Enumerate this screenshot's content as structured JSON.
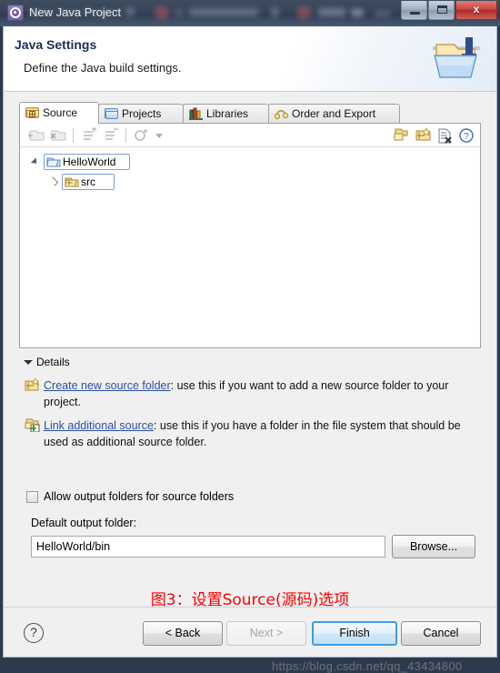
{
  "window": {
    "title": "New Java Project",
    "app_icon": "gear-icon",
    "controls": {
      "minimize": "minimize-button",
      "maximize": "maximize-button",
      "close_label": "x"
    }
  },
  "banner": {
    "title": "Java Settings",
    "subtitle": "Define the Java build settings.",
    "icon": "java-folder-icon"
  },
  "tabs": [
    {
      "label": "Source",
      "icon": "package-folder-icon",
      "active": true
    },
    {
      "label": "Projects",
      "icon": "open-folder-icon",
      "active": false
    },
    {
      "label": "Libraries",
      "icon": "books-icon",
      "active": false
    },
    {
      "label": "Order and Export",
      "icon": "order-export-icon",
      "active": false
    }
  ],
  "toolbar": {
    "left_buttons": [
      {
        "name": "add-folder-button",
        "enabled": false
      },
      {
        "name": "remove-folder-button",
        "enabled": false
      },
      {
        "name": "add-exclusion-button",
        "enabled": false
      },
      {
        "name": "remove-exclusion-button",
        "enabled": false
      },
      {
        "name": "configure-filters-button",
        "enabled": false
      }
    ],
    "right_buttons": [
      {
        "name": "link-source-button",
        "enabled": true
      },
      {
        "name": "create-source-folder-button",
        "enabled": true
      },
      {
        "name": "remove-source-button",
        "enabled": true
      },
      {
        "name": "help-button",
        "enabled": true
      }
    ]
  },
  "tree": {
    "nodes": [
      {
        "label": "HelloWorld",
        "icon": "project-folder-icon",
        "expanded": true,
        "selected": true,
        "indent": 0
      },
      {
        "label": "src",
        "icon": "source-folder-icon",
        "expanded": false,
        "selected": false,
        "indent": 1
      }
    ]
  },
  "details": {
    "header": "Details",
    "items": [
      {
        "icon": "create-source-folder-icon",
        "link": "Create new source folder",
        "text": ": use this if you want to add a new source folder to your project."
      },
      {
        "icon": "link-source-icon",
        "link": "Link additional source",
        "text": ": use this if you have a folder in the file system that should be used as additional source folder."
      }
    ]
  },
  "options": {
    "allow_output_folders": {
      "label": "Allow output folders for source folders",
      "checked": false
    },
    "default_output_folder": {
      "label": "Default output folder:",
      "value": "HelloWorld/bin",
      "placeholder": "",
      "browse_label": "Browse..."
    }
  },
  "annotation": {
    "caption": "图3：设置Source(源码)选项",
    "color": "#fe0000"
  },
  "footer": {
    "help_label": "?",
    "buttons": [
      {
        "label": "< Back",
        "state": "enabled",
        "name": "back-button"
      },
      {
        "label": "Next >",
        "state": "disabled",
        "name": "next-button"
      },
      {
        "label": "Finish",
        "state": "default",
        "name": "finish-button"
      },
      {
        "label": "Cancel",
        "state": "enabled",
        "name": "cancel-button"
      }
    ]
  },
  "watermark": "https://blog.csdn.net/qq_43434800"
}
